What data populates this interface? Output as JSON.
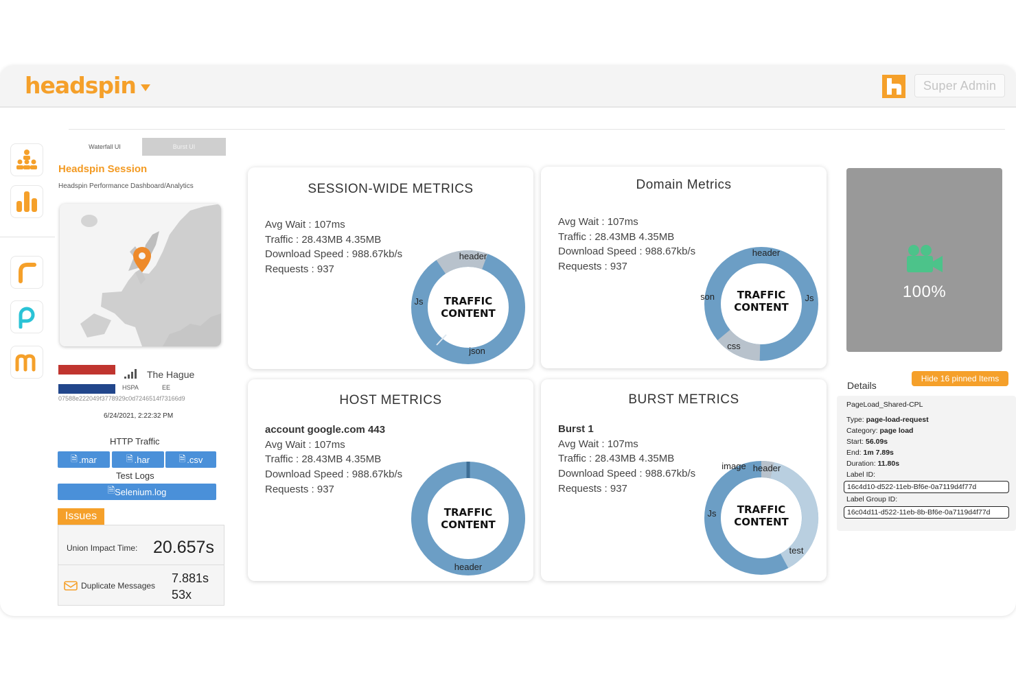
{
  "header": {
    "brand": "headspin",
    "user_button": "Super Admin"
  },
  "tabs": [
    {
      "label": "Waterfall UI",
      "active": false
    },
    {
      "label": "Burst UI",
      "active": true
    }
  ],
  "session": {
    "title": "Headspin Session",
    "subtitle": "Headspin Performance Dashboard/Analytics",
    "city": "The Hague",
    "network": "HSPA",
    "carrier": "EE",
    "device_id": "07588e222049f3778929c0d7246514f73166d9",
    "datetime": "6/24/2021, 2:22:32 PM"
  },
  "http_traffic": {
    "title": "HTTP Traffic",
    "buttons": [
      ".mar",
      ".har",
      ".csv"
    ]
  },
  "test_logs": {
    "title": "Test Logs",
    "button": "Selenium.log"
  },
  "issues": {
    "badge": "Issues",
    "union_label": "Union Impact Time:",
    "union_value": "20.657s",
    "dup_label": "Duplicate Messages",
    "dup_time": "7.881s",
    "dup_count": "53x"
  },
  "cards": {
    "session": {
      "title": "SESSION-WIDE METRICS",
      "lines": [
        "Avg Wait : 107ms",
        "Traffic : 28.43MB 4.35MB",
        "Download Speed : 988.67kb/s",
        "Requests : 937"
      ],
      "donut_center_1": "TRAFFIC",
      "donut_center_2": "CONTENT",
      "segments": [
        "header",
        "Js",
        "json"
      ]
    },
    "domain": {
      "title": "Domain Metrics",
      "lines": [
        "Avg Wait : 107ms",
        "Traffic : 28.43MB 4.35MB",
        "Download Speed : 988.67kb/s",
        "Requests : 937"
      ],
      "donut_center_1": "TRAFFIC",
      "donut_center_2": "CONTENT",
      "segments": [
        "header",
        "json",
        "Js",
        "css"
      ]
    },
    "host": {
      "title": "HOST METRICS",
      "heading": "account google.com 443",
      "lines": [
        "Avg Wait : 107ms",
        "Traffic : 28.43MB 4.35MB",
        "Download Speed : 988.67kb/s",
        "Requests : 937"
      ],
      "donut_center_1": "TRAFFIC",
      "donut_center_2": "CONTENT",
      "segments": [
        "header"
      ]
    },
    "burst": {
      "title": "BURST METRICS",
      "heading": "Burst 1",
      "lines": [
        "Avg Wait : 107ms",
        "Traffic : 28.43MB 4.35MB",
        "Download Speed : 988.67kb/s",
        "Requests : 937"
      ],
      "donut_center_1": "TRAFFIC",
      "donut_center_2": "CONTENT",
      "segments": [
        "image",
        "header",
        "Js",
        "test"
      ]
    }
  },
  "video": {
    "progress": "100%"
  },
  "details": {
    "title": "Details",
    "hide_button": "Hide 16 pinned Items",
    "name": "PageLoad_Shared-CPL",
    "type_label": "Type:",
    "type_value": "page-load-request",
    "category_label": "Category:",
    "category_value": "page load",
    "start_label": "Start:",
    "start_value": "56.09s",
    "end_label": "End:",
    "end_value": "1m 7.89s",
    "duration_label": "Duration:",
    "duration_value": "11.80s",
    "label_id_label": "Label ID:",
    "label_id": "16c4d10-d522-11eb-Bf6e-0a7119d4f77d",
    "label_group_label": "Label Group ID:",
    "label_group_id": "16c04d11-d522-11eb-8b-Bf6e-0a7119d4f77d"
  },
  "colors": {
    "brand": "#f5a02a",
    "button_blue": "#4a90d9",
    "donut_blue": "#6c9ec5",
    "donut_light": "#b9cfe0",
    "donut_gray": "#b8c2cc"
  }
}
